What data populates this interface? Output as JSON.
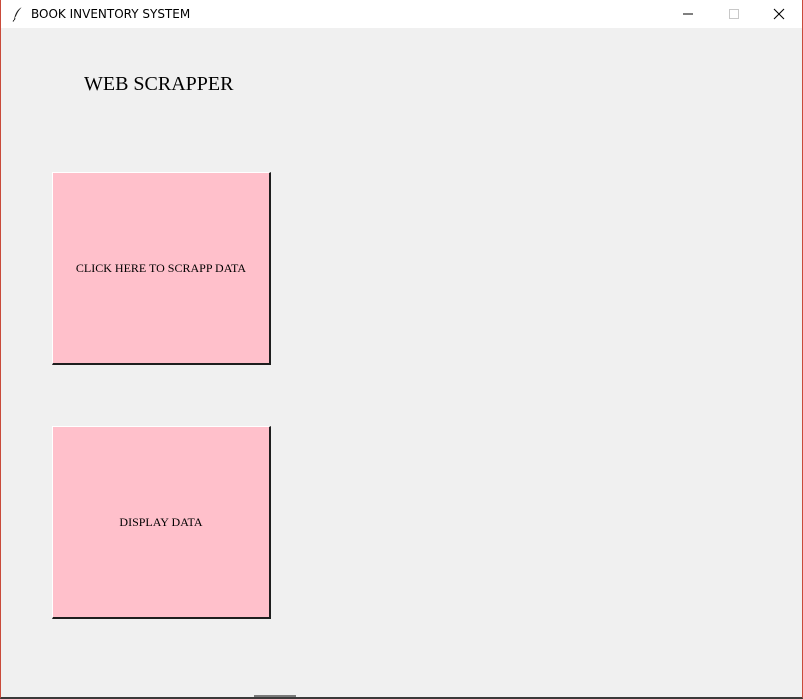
{
  "window": {
    "title": "BOOK INVENTORY SYSTEM",
    "app_icon": "feather-icon",
    "controls": {
      "minimize_icon": "minimize-icon",
      "maximize_icon": "maximize-icon",
      "close_icon": "close-icon"
    }
  },
  "main": {
    "heading": "WEB SCRAPPER",
    "buttons": {
      "scrape_label": "CLICK HERE TO SCRAPP DATA",
      "display_label": "DISPLAY DATA"
    }
  },
  "colors": {
    "button_bg": "#ffc0cb",
    "window_bg": "#f0f0f0",
    "titlebar_bg": "#ffffff"
  }
}
